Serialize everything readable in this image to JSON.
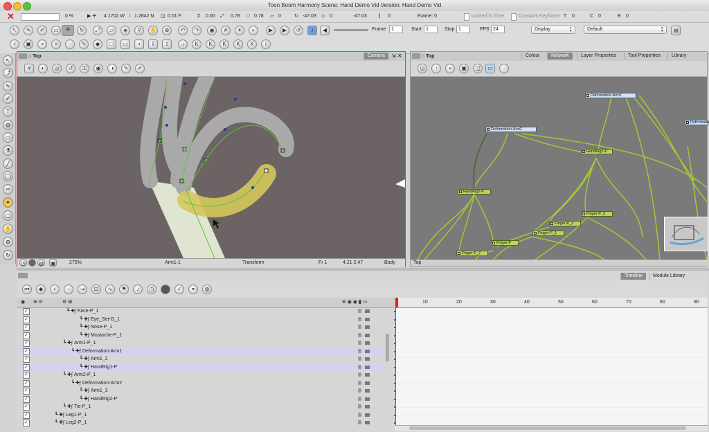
{
  "window": {
    "title": "Toon Boom Harmony Scene: Hand Demo Vid Version: Hand Demo Vid"
  },
  "transform_bar": {
    "percent": "0 %",
    "width_value": "4.1702 W",
    "height_value": "1.2842 N",
    "z_value": "0.01 F",
    "angle_value": "0.00",
    "scale_x": "0.78",
    "scale_y": "0.78",
    "skew_a": "0",
    "skew_b": "-47.03",
    "offset": "0",
    "frame_label": "Frame: 0",
    "locked_in_time": "Locked in Time",
    "constant_keyframe": "Constant Keyframe",
    "t_label": "T",
    "t_value": "0",
    "c_label": "C",
    "c_value": "0",
    "b_label": "B",
    "b_value": "0"
  },
  "playback": {
    "frame_label": "Frame",
    "frame_value": "1",
    "start_label": "Start",
    "start_value": "1",
    "stop_label": "Stop",
    "stop_value": "1",
    "fps_label": "FPS",
    "fps_value": "24",
    "display_select": "Display",
    "default_select": "Default"
  },
  "camera_view": {
    "title": "Top",
    "tab_camera": "Camera",
    "status_zoom": "275%",
    "status_layer": "Arm1-1",
    "status_tool": "Transform",
    "status_frame": "Fr 1",
    "status_coords": "4.21 2.47",
    "status_body": "Body"
  },
  "node_view": {
    "title": "Top",
    "tabs": [
      "Colour",
      "Network",
      "Layer Properties",
      "Tool Properties",
      "Library"
    ],
    "active_tab": "Network",
    "footer": "Top",
    "nodes": [
      "Deformation-Arm1",
      "Deformation-Arm2",
      "Deformation-",
      "HandRig1-P",
      "HandRig2-P",
      "Finger-P_3",
      "Finger-P_2",
      "Finger-P_1",
      "Finger-P",
      "Finger-P_7"
    ]
  },
  "timeline": {
    "tabs": [
      "Timeline",
      "Module Library"
    ],
    "active_tab": "Timeline",
    "ruler": [
      "10",
      "20",
      "30",
      "40",
      "50",
      "60",
      "70",
      "80",
      "90"
    ],
    "layers": [
      {
        "name": "Face-P_1",
        "indent": 85,
        "selected": false
      },
      {
        "name": "Eye_Set-G_1",
        "indent": 104,
        "selected": false
      },
      {
        "name": "Nose-P_1",
        "indent": 104,
        "selected": false
      },
      {
        "name": "Mustache-P_1",
        "indent": 104,
        "selected": false
      },
      {
        "name": "Arm1-P_1",
        "indent": 80,
        "selected": false
      },
      {
        "name": "Deformation-Arm1",
        "indent": 92,
        "selected": true
      },
      {
        "name": "Arm1_2",
        "indent": 104,
        "selected": false
      },
      {
        "name": "HandRig1-P",
        "indent": 104,
        "selected": true
      },
      {
        "name": "Arm2-P_1",
        "indent": 80,
        "selected": false
      },
      {
        "name": "Deformation-Arm2",
        "indent": 92,
        "selected": false
      },
      {
        "name": "Arm1_3",
        "indent": 104,
        "selected": false
      },
      {
        "name": "HandRig2-P",
        "indent": 104,
        "selected": false
      },
      {
        "name": "Tie-P_1",
        "indent": 80,
        "selected": false
      },
      {
        "name": "Leg1-P_1",
        "indent": 68,
        "selected": false
      },
      {
        "name": "Leg2-P_1",
        "indent": 68,
        "selected": false
      }
    ]
  },
  "colors": {
    "camera_bg": "#6c6364",
    "node_bg": "#7a7a7a",
    "wire": "#a6c933",
    "selection": "#d3d3ee",
    "panel_border": "#d44040"
  }
}
